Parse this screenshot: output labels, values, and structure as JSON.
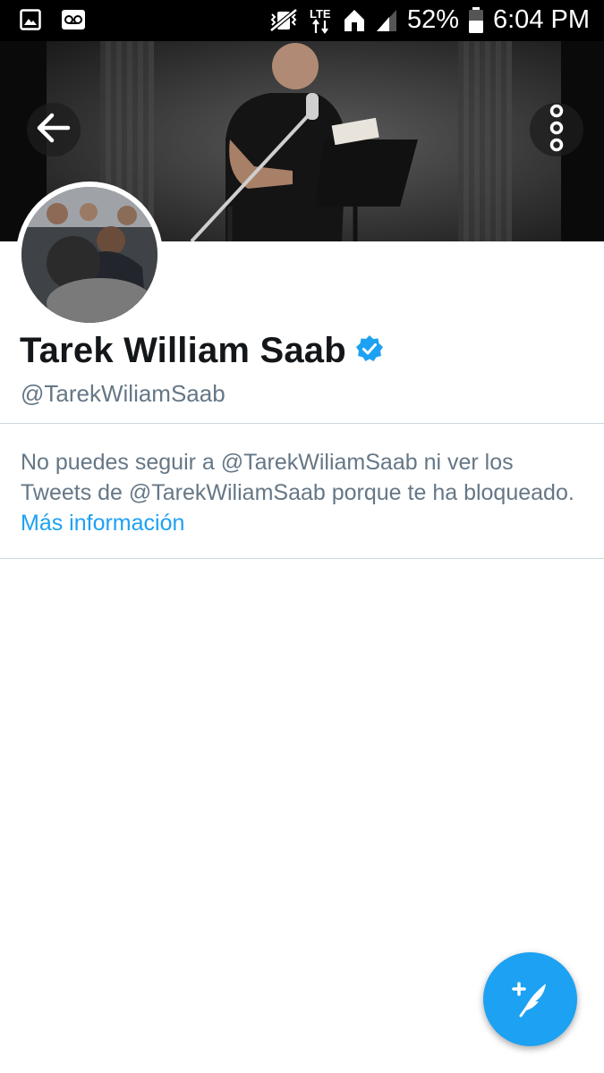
{
  "status_bar": {
    "battery_percent": "52%",
    "time": "6:04 PM",
    "network_label": "LTE"
  },
  "profile": {
    "display_name": "Tarek William Saab",
    "handle": "@TarekWiliamSaab",
    "verified": true
  },
  "blocked_notice": {
    "message": "No puedes seguir a @TarekWiliamSaab ni ver los Tweets de @TarekWiliamSaab porque te ha bloqueado.",
    "link_text": "Más información"
  },
  "colors": {
    "accent": "#1da1f2",
    "secondary_text": "#657786",
    "primary_text": "#14171a"
  },
  "icons": {
    "back": "arrow-left-icon",
    "more": "more-vertical-icon",
    "compose": "compose-tweet-icon",
    "verified": "verified-badge-icon"
  }
}
